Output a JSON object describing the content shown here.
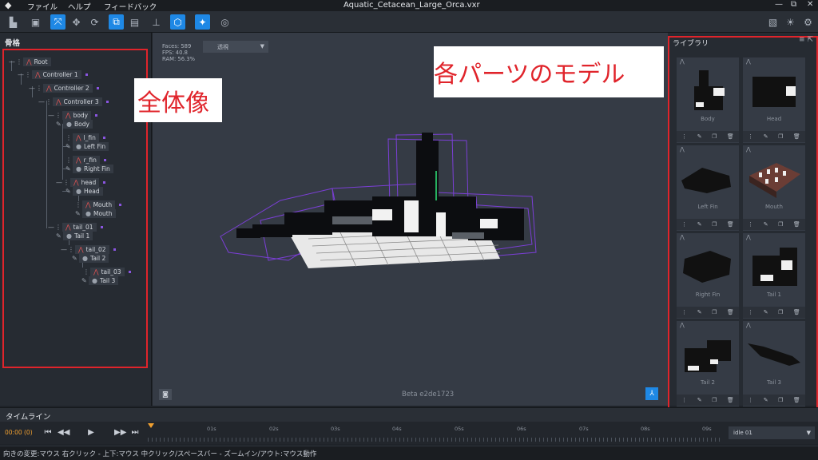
{
  "window": {
    "title": "Aquatic_Cetacean_Large_Orca.vxr",
    "menu": [
      "ファイル",
      "ヘルプ",
      "フィードバック"
    ],
    "controls": [
      "—",
      "⧉",
      "✕"
    ]
  },
  "toolbar": {
    "icons": [
      "new-file-icon",
      "save-icon",
      "expand-icon",
      "move-icon",
      "rotate-icon",
      "bone-attach-icon",
      "bone-add-icon",
      "hierarchy-icon",
      "cube-icon",
      "sparkle-icon",
      "target-icon"
    ],
    "right_icons": [
      "photo-icon",
      "light-icon",
      "settings-icon"
    ],
    "accent": "#1e88e5"
  },
  "skeleton": {
    "title": "骨格",
    "nodes": [
      {
        "label": "Root",
        "type": "bone"
      },
      {
        "label": "Controller 1",
        "type": "bone"
      },
      {
        "label": "Controller 2",
        "type": "bone"
      },
      {
        "label": "Controller 3",
        "type": "bone"
      },
      {
        "label": "body",
        "type": "bone"
      },
      {
        "label": "Body",
        "type": "mesh"
      },
      {
        "label": "l_fin",
        "type": "bone"
      },
      {
        "label": "Left Fin",
        "type": "mesh"
      },
      {
        "label": "r_fin",
        "type": "bone"
      },
      {
        "label": "Right Fin",
        "type": "mesh"
      },
      {
        "label": "head",
        "type": "bone"
      },
      {
        "label": "Head",
        "type": "mesh"
      },
      {
        "label": "Mouth",
        "type": "bone"
      },
      {
        "label": "Mouth",
        "type": "mesh"
      },
      {
        "label": "tail_01",
        "type": "bone"
      },
      {
        "label": "Tail 1",
        "type": "mesh"
      },
      {
        "label": "tail_02",
        "type": "bone"
      },
      {
        "label": "Tail 2",
        "type": "mesh"
      },
      {
        "label": "tail_03",
        "type": "bone"
      },
      {
        "label": "Tail 3",
        "type": "mesh"
      }
    ]
  },
  "viewport": {
    "stats": [
      "Faces: 589",
      "FPS: 40.8",
      "RAM: 56.3%"
    ],
    "view_mode": "透視",
    "version": "Beta e2de1723"
  },
  "annotations": {
    "whole": "全体像",
    "parts": "各パーツのモデル"
  },
  "library": {
    "title": "ライブラリ",
    "items": [
      "Body",
      "Head",
      "Left Fin",
      "Mouth",
      "Right Fin",
      "Tail 1",
      "Tail 2",
      "Tail 3"
    ]
  },
  "timeline": {
    "title": "タイムライン",
    "current_time": "00:00 (0)",
    "ticks": [
      "01s",
      "02s",
      "03s",
      "04s",
      "05s",
      "06s",
      "07s",
      "08s",
      "09s"
    ],
    "animation": "idle 01",
    "playhead_accent": "#f0a030"
  },
  "status": {
    "text": "向きの変更:マウス 右クリック - 上下:マウス 中クリック/スペースバー - ズームイン/アウト:マウス動作"
  }
}
